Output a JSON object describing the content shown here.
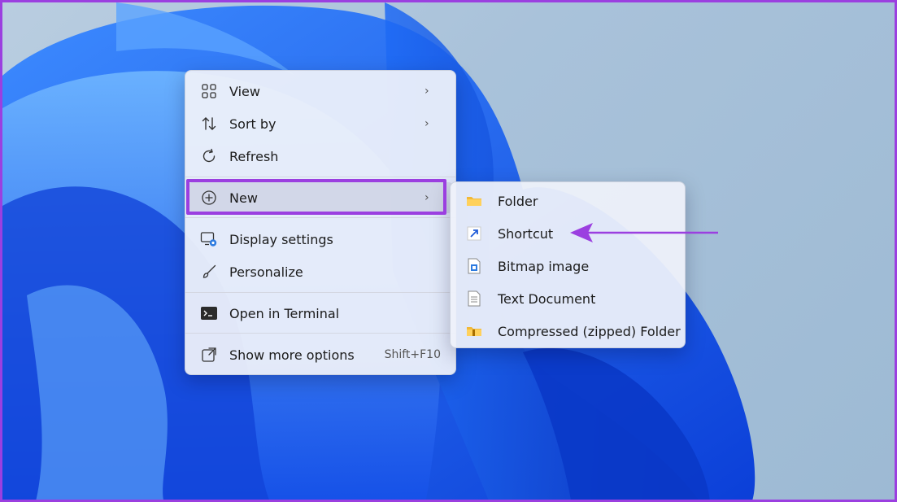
{
  "context_menu": {
    "items": [
      {
        "label": "View",
        "icon": "grid-icon",
        "has_submenu": true
      },
      {
        "label": "Sort by",
        "icon": "sort-icon",
        "has_submenu": true
      },
      {
        "label": "Refresh",
        "icon": "refresh-icon",
        "has_submenu": false
      },
      {
        "label": "New",
        "icon": "plus-circle-icon",
        "has_submenu": true,
        "selected": true
      },
      {
        "label": "Display settings",
        "icon": "display-settings-icon",
        "has_submenu": false
      },
      {
        "label": "Personalize",
        "icon": "brush-icon",
        "has_submenu": false
      },
      {
        "label": "Open in Terminal",
        "icon": "terminal-icon",
        "has_submenu": false
      },
      {
        "label": "Show more options",
        "icon": "external-options-icon",
        "shortcut": "Shift+F10"
      }
    ]
  },
  "new_submenu": {
    "items": [
      {
        "label": "Folder",
        "icon": "folder-icon"
      },
      {
        "label": "Shortcut",
        "icon": "shortcut-arrow-icon"
      },
      {
        "label": "Bitmap image",
        "icon": "bitmap-file-icon"
      },
      {
        "label": "Text Document",
        "icon": "text-file-icon"
      },
      {
        "label": "Compressed (zipped) Folder",
        "icon": "zip-folder-icon"
      }
    ]
  },
  "colors": {
    "annotation": "#9b3fe0",
    "wallpaper_blue": "#1f5bf0",
    "menu_background": "#eef1fa"
  }
}
